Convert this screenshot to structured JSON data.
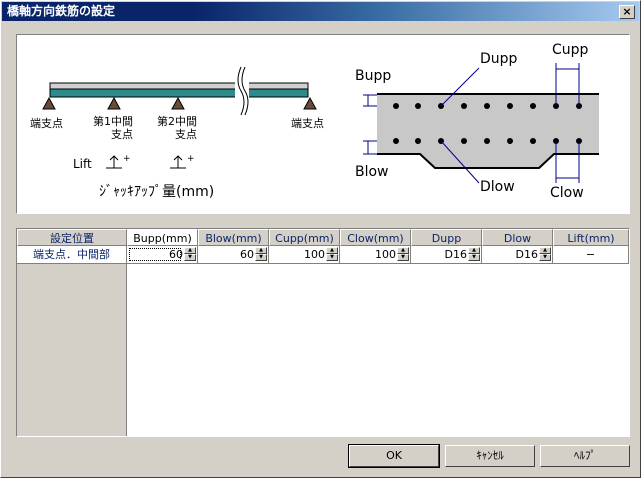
{
  "window": {
    "title": "橋軸方向鉄筋の設定",
    "close_label": "×"
  },
  "diagram": {
    "left": {
      "support_end_left": "端支点",
      "support_mid1_line1": "第1中間",
      "support_mid1_line2": "支点",
      "support_mid2_line1": "第2中間",
      "support_mid2_line2": "支点",
      "support_end_right": "端支点",
      "lift_label": "Lift",
      "jack_label": "ｼﾞｬｯｷｱｯﾌﾟ量(mm)"
    },
    "right": {
      "bupp": "Bupp",
      "blow": "Blow",
      "dupp": "Dupp",
      "dlow": "Dlow",
      "cupp": "Cupp",
      "clow": "Clow"
    }
  },
  "grid": {
    "header_position": "設定位置",
    "columns": [
      "Bupp(mm)",
      "Blow(mm)",
      "Cupp(mm)",
      "Clow(mm)",
      "Dupp",
      "Dlow",
      "Lift(mm)"
    ],
    "rows": [
      {
        "position": "端支点．中間部",
        "bupp": "60",
        "blow": "60",
        "cupp": "100",
        "clow": "100",
        "dupp": "D16",
        "dlow": "D16",
        "lift": "−"
      }
    ]
  },
  "buttons": {
    "ok": "OK",
    "cancel": "ｷｬﾝｾﾙ",
    "help": "ﾍﾙﾌﾟ"
  }
}
